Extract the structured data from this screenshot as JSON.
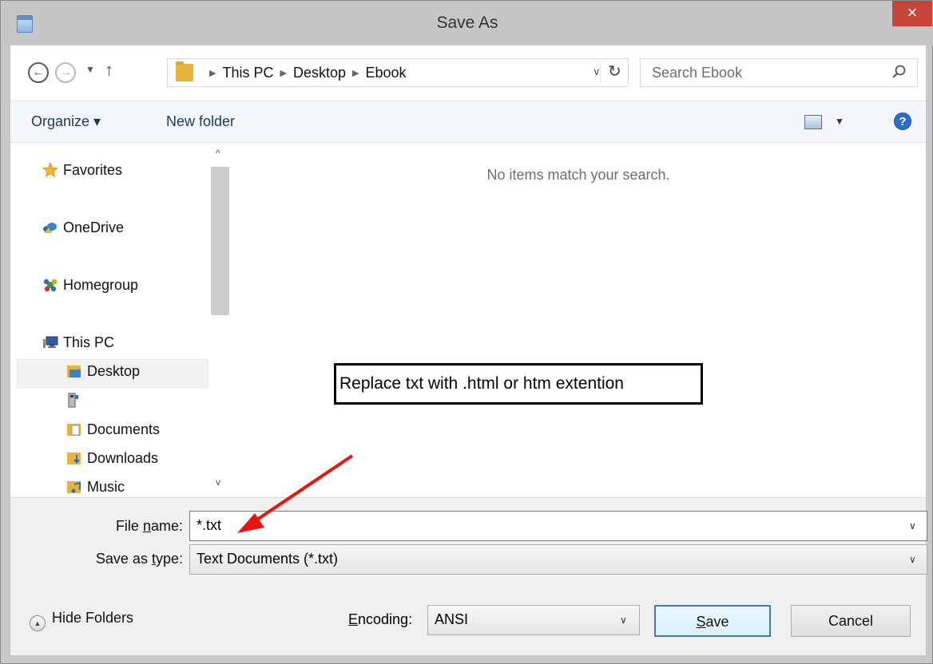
{
  "window": {
    "title": "Save As",
    "close_glyph": "×"
  },
  "nav": {
    "back_glyph": "←",
    "forward_glyph": "→",
    "recent_glyph": "▼",
    "up_glyph": "↑"
  },
  "address": {
    "crumbs": [
      "This PC",
      "Desktop",
      "Ebook"
    ],
    "separator": "▶",
    "dropdown_glyph": "∨",
    "refresh_glyph": "↻"
  },
  "search": {
    "placeholder": "Search Ebook"
  },
  "toolbar": {
    "organize_label": "Organize ▾",
    "new_folder_label": "New folder",
    "view_dropdown_glyph": "▼",
    "help_label": "?"
  },
  "navpane": {
    "scroll_up_glyph": "^",
    "scroll_down_glyph": "v",
    "favorites": "Favorites",
    "onedrive": "OneDrive",
    "homegroup": "Homegroup",
    "this_pc": "This PC",
    "desktop": "Desktop",
    "documents": "Documents",
    "downloads": "Downloads",
    "music": "Music"
  },
  "filelist": {
    "empty_message": "No items match your search."
  },
  "annotation": {
    "text": "Replace txt with .html or htm extention"
  },
  "form": {
    "file_name_label_pre": "File ",
    "file_name_label_u": "n",
    "file_name_label_post": "ame:",
    "file_name_value": "*.txt",
    "save_type_label_pre": "Save as ",
    "save_type_label_u": "t",
    "save_type_label_post": "ype:",
    "save_type_value": "Text Documents (*.txt)",
    "encoding_label_u": "E",
    "encoding_label_post": "ncoding:",
    "encoding_value": "ANSI",
    "dropdown_glyph": "∨"
  },
  "buttons": {
    "hide_folders": "Hide Folders",
    "hide_folders_glyph": "▲",
    "save_u": "S",
    "save_post": "ave",
    "cancel": "Cancel"
  },
  "colors": {
    "close_red": "#c7443a",
    "link_blue": "#1e395b",
    "annotation_arrow": "#e8140f"
  }
}
